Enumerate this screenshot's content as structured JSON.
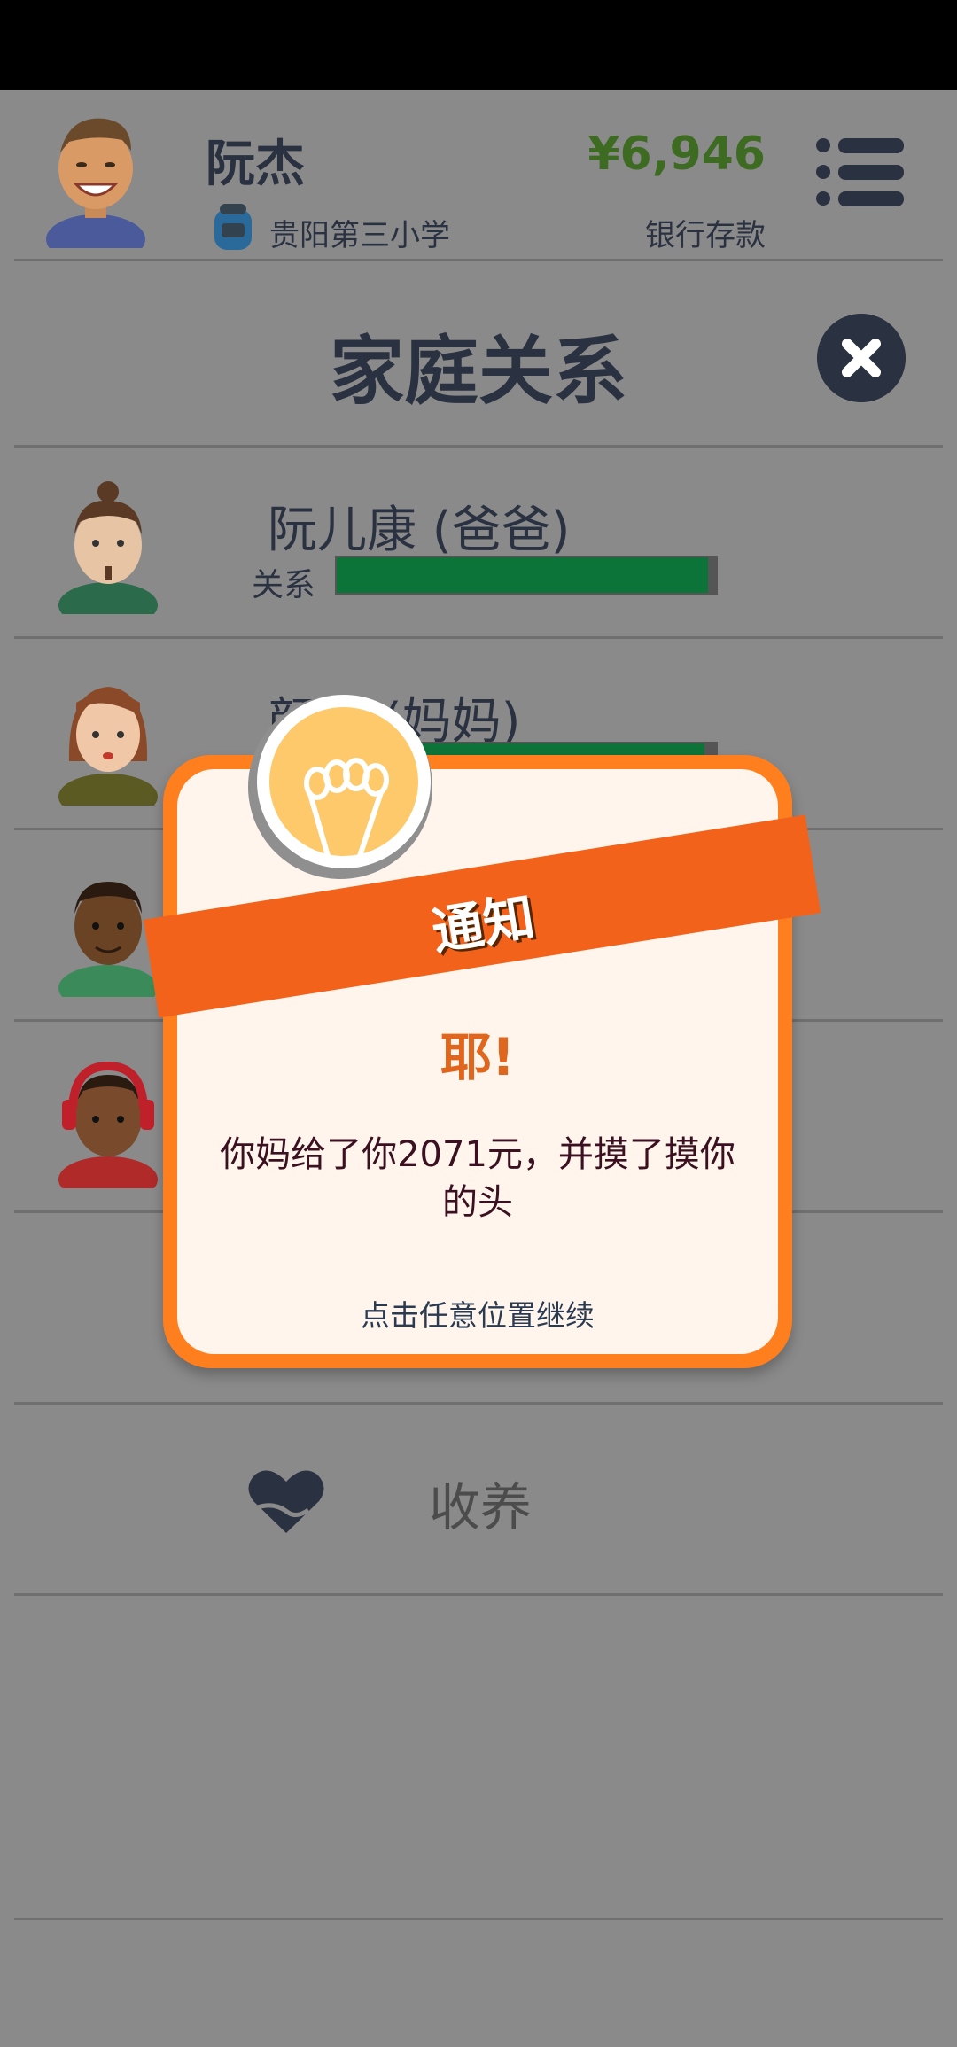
{
  "header": {
    "player_name": "阮杰",
    "school": "贵阳第三小学",
    "money": "¥6,946",
    "money_label": "银行存款"
  },
  "section": {
    "title": "家庭关系"
  },
  "family": [
    {
      "name": "阮儿康 (爸爸)",
      "relation_label": "关系",
      "relation": 0.98
    },
    {
      "name": "颜妈 (妈妈)",
      "relation_label": "",
      "relation": 0.97
    },
    {
      "name": "",
      "relation_label": "",
      "relation": 0
    },
    {
      "name": "",
      "relation_label": "",
      "relation": 0
    }
  ],
  "actions": {
    "adopt_label": "收养"
  },
  "modal": {
    "ribbon": "通知",
    "heading": "耶!",
    "body": "你妈给了你2071元，并摸了摸你的头",
    "hint": "点击任意位置继续"
  },
  "colors": {
    "accent": "#ff7f1f",
    "money": "#3e6b22",
    "bar": "#0c7439"
  }
}
